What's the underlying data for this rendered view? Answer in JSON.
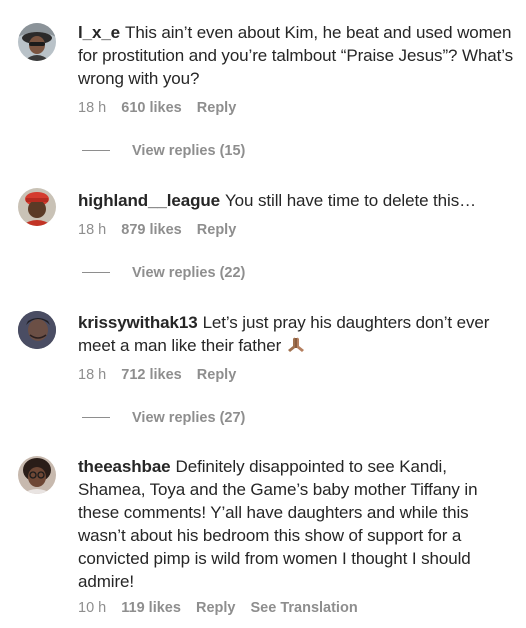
{
  "comments": [
    {
      "username": "l_x_e",
      "text": "This ain’t even about Kim, he beat and used women for prostitution and you’re talmbout “Praise Jesus”? What’s wrong with you?",
      "time": "18 h",
      "likes": "610 likes",
      "reply": "Reply",
      "view_replies": "View replies (15)"
    },
    {
      "username": "highland__league",
      "text": "You still have time to delete this…",
      "time": "18 h",
      "likes": "879 likes",
      "reply": "Reply",
      "view_replies": "View replies (22)"
    },
    {
      "username": "krissywithak13",
      "text": "Let’s just pray his daughters don’t ever meet a man like their father",
      "emoji": "folded-hands",
      "time": "18 h",
      "likes": "712 likes",
      "reply": "Reply",
      "view_replies": "View replies (27)"
    },
    {
      "username": "theeashbae",
      "text": "Definitely disappointed to see Kandi, Shamea, Toya and the Game’s baby mother Tiffany in these comments! Y’all have daughters and while this wasn’t about his bedroom this show of support for a convicted pimp is wild from women I thought I should admire!",
      "time": "10 h",
      "likes": "119 likes",
      "reply": "Reply",
      "see_translation": "See Translation"
    }
  ]
}
